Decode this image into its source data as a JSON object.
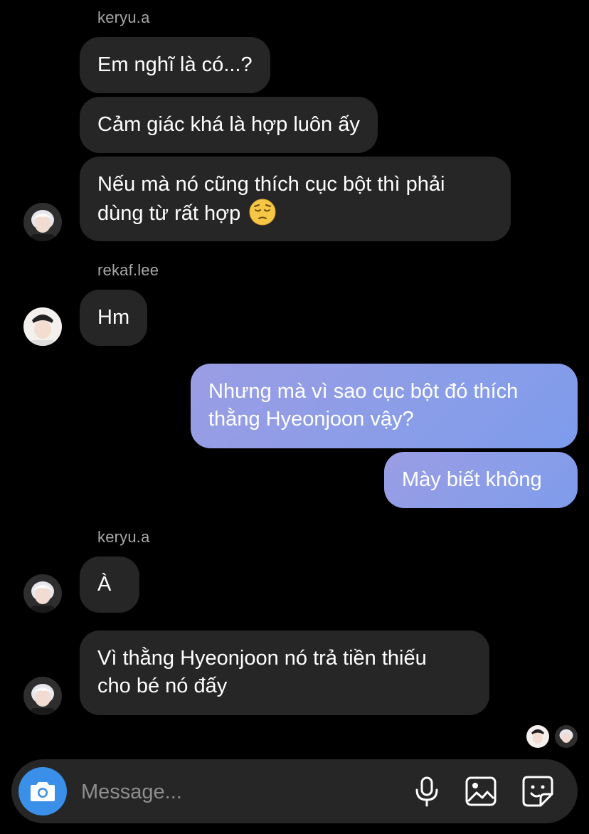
{
  "conversation": {
    "groups": [
      {
        "sender": "keryu.a",
        "messages": [
          {
            "text": "Em nghĩ là có...?"
          },
          {
            "text": "Cảm giác khá là hợp luôn ấy"
          },
          {
            "line1": "Nếu mà nó cũng thích cục bột thì phải",
            "line2": "dùng từ rất hợp",
            "emoji": "pensive-face-emoji"
          }
        ]
      },
      {
        "sender": "rekaf.lee",
        "messages": [
          {
            "text": "Hm"
          }
        ]
      },
      {
        "sender": "me",
        "messages": [
          {
            "line1": "Nhưng mà vì sao cục bột đó thích",
            "line2": "thằng Hyeonjoon vậy?"
          },
          {
            "text": "Mày biết không"
          }
        ]
      },
      {
        "sender": "keryu.a",
        "messages": [
          {
            "text": "À"
          },
          {
            "line1": "Vì thằng Hyeonjoon nó trả tiền thiếu",
            "line2": "cho bé nó đấy"
          }
        ]
      }
    ]
  },
  "composer": {
    "placeholder": "Message...",
    "icons": [
      "camera-icon",
      "microphone-icon",
      "gallery-icon",
      "sticker-icon"
    ]
  },
  "colors": {
    "background": "#000000",
    "incoming_bubble": "#262626",
    "outgoing_gradient_start": "#9a9de4",
    "outgoing_gradient_end": "#7d9cec",
    "camera_button": "#3a8fe8",
    "sender_name": "#a8a8a8"
  }
}
